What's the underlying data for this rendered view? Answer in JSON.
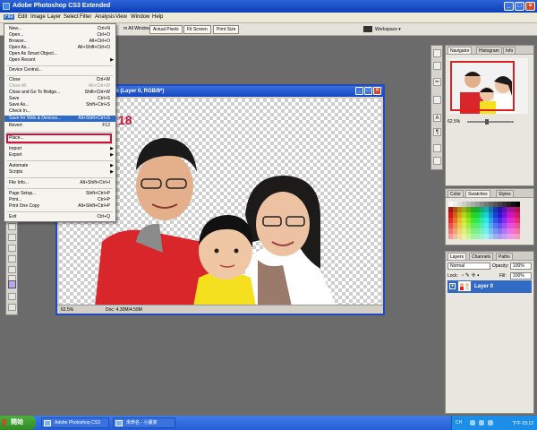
{
  "window": {
    "title": "Adobe Photoshop CS3 Extended"
  },
  "menubar": {
    "items": [
      "File",
      "Edit",
      "Image",
      "Layer",
      "Select",
      "Filter",
      "Analysis",
      "View",
      "Window",
      "Help"
    ]
  },
  "optionsbar": {
    "partial_label": "m All Windows",
    "actual_pixels": "Actual Pixels",
    "fit_screen": "Fit Screen",
    "print_size": "Print Size",
    "workspace": "Workspace ▾"
  },
  "file_menu": {
    "items": [
      {
        "label": "New...",
        "shortcut": "Ctrl+N"
      },
      {
        "label": "Open...",
        "shortcut": "Ctrl+O"
      },
      {
        "label": "Browse...",
        "shortcut": "Alt+Ctrl+O"
      },
      {
        "label": "Open As...",
        "shortcut": "Alt+Shift+Ctrl+O"
      },
      {
        "label": "Open As Smart Object...",
        "shortcut": ""
      },
      {
        "label": "Open Recent",
        "shortcut": ""
      },
      {
        "label": "Device Central...",
        "shortcut": ""
      },
      {
        "label": "Close",
        "shortcut": "Ctrl+W"
      },
      {
        "label": "Close All",
        "shortcut": "Alt+Ctrl+W"
      },
      {
        "label": "Close and Go To Bridge...",
        "shortcut": "Shift+Ctrl+W"
      },
      {
        "label": "Save",
        "shortcut": "Ctrl+S"
      },
      {
        "label": "Save As...",
        "shortcut": "Shift+Ctrl+S"
      },
      {
        "label": "Check In...",
        "shortcut": ""
      },
      {
        "label": "Save for Web & Devices...",
        "shortcut": "Alt+Shift+Ctrl+S"
      },
      {
        "label": "Revert",
        "shortcut": "F12"
      },
      {
        "label": "Place...",
        "shortcut": ""
      },
      {
        "label": "Import",
        "shortcut": ""
      },
      {
        "label": "Export",
        "shortcut": ""
      },
      {
        "label": "Automate",
        "shortcut": ""
      },
      {
        "label": "Scripts",
        "shortcut": ""
      },
      {
        "label": "File Info...",
        "shortcut": "Alt+Shift+Ctrl+I"
      },
      {
        "label": "Page Setup...",
        "shortcut": "Shift+Ctrl+P"
      },
      {
        "label": "Print...",
        "shortcut": "Ctrl+P"
      },
      {
        "label": "Print One Copy",
        "shortcut": "Alt+Shift+Ctrl+P"
      },
      {
        "label": "Exit",
        "shortcut": "Ctrl+Q"
      }
    ],
    "callout_number": "18"
  },
  "document": {
    "title": "9% (Layer 0, RGB/8*)",
    "zoom": "62.5%",
    "doc_info": "Doc: 4.30M/4.59M"
  },
  "navigator": {
    "tabs": [
      "Navigator",
      "Histogram",
      "Info"
    ],
    "zoom": "62.5%"
  },
  "swatches": {
    "tabs": [
      "Color",
      "Swatches",
      "Styles"
    ]
  },
  "layers": {
    "tabs": [
      "Layers",
      "Channels",
      "Paths"
    ],
    "blend_mode": "Normal",
    "opacity_label": "Opacity:",
    "opacity_value": "100%",
    "lock_label": "Lock:",
    "fill_label": "Fill:",
    "fill_value": "100%",
    "layer_name": "Layer 0"
  },
  "taskbar": {
    "start_label": "開始",
    "task1": "Adobe Photoshop CS3",
    "task2": "未命名 - 小畫家",
    "ime": "CH",
    "clock": "下午 03:12"
  }
}
